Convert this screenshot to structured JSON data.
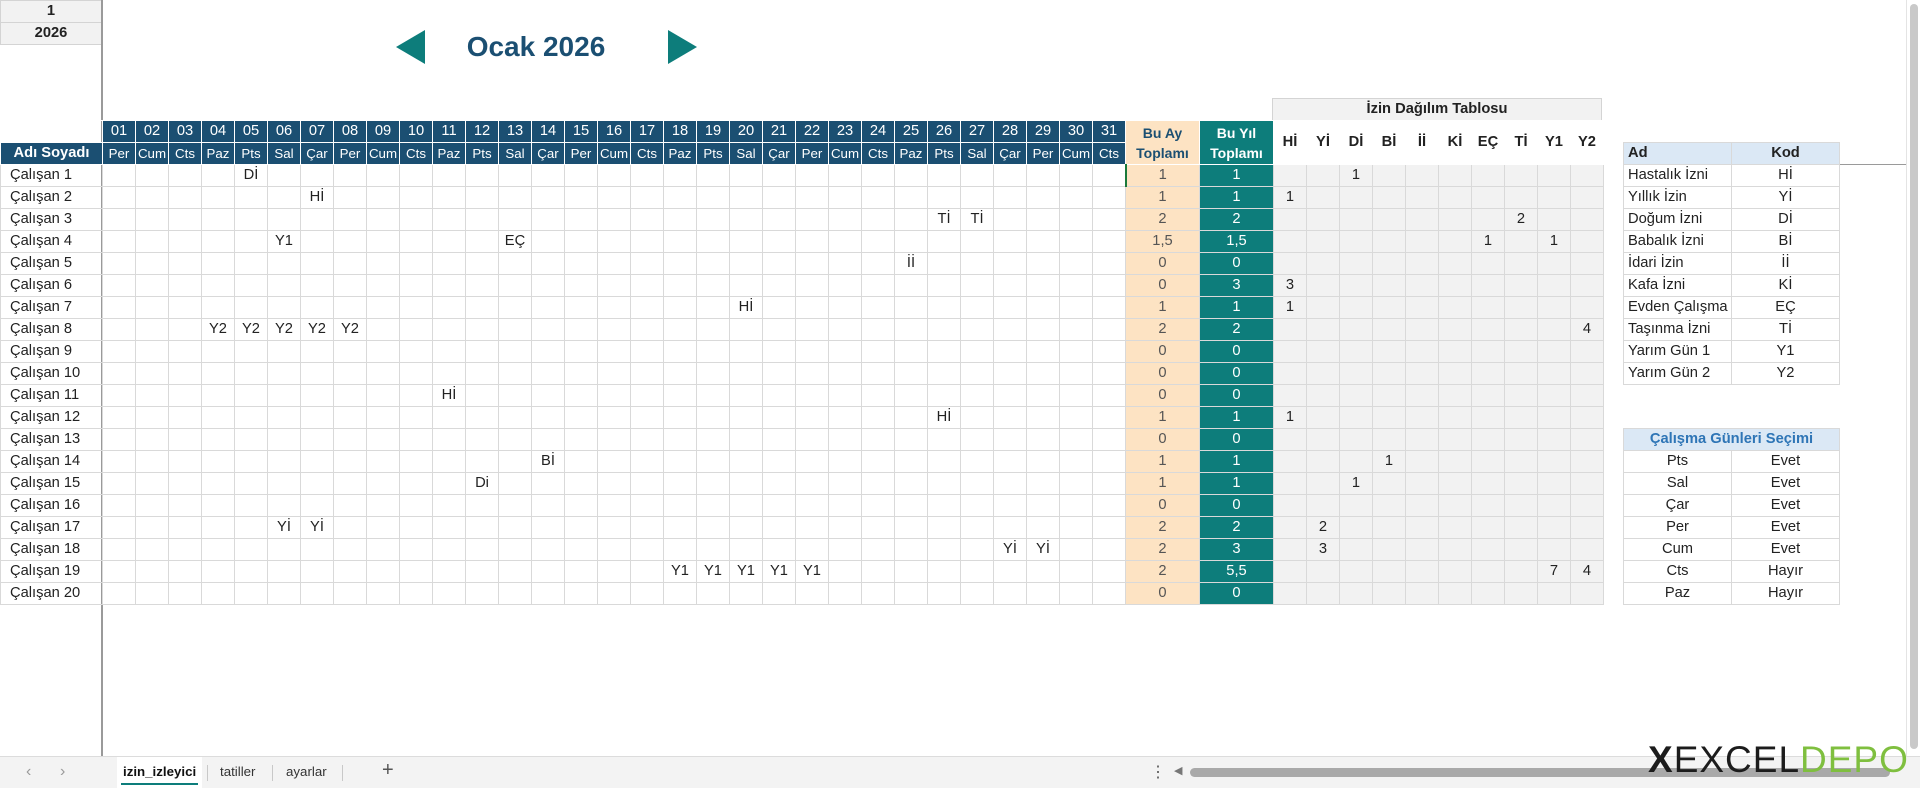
{
  "corner": {
    "month_num": "1",
    "year": "2026"
  },
  "nav": {
    "title": "Ocak 2026"
  },
  "grid": {
    "name_header": "Adı Soyadı",
    "month_total_header": "Bu Ay Toplamı",
    "year_total_header": "Bu Yıl Toplamı",
    "day_numbers": [
      "01",
      "02",
      "03",
      "04",
      "05",
      "06",
      "07",
      "08",
      "09",
      "10",
      "11",
      "12",
      "13",
      "14",
      "15",
      "16",
      "17",
      "18",
      "19",
      "20",
      "21",
      "22",
      "23",
      "24",
      "25",
      "26",
      "27",
      "28",
      "29",
      "30",
      "31"
    ],
    "day_names": [
      "Per",
      "Cum",
      "Cts",
      "Paz",
      "Pts",
      "Sal",
      "Çar",
      "Per",
      "Cum",
      "Cts",
      "Paz",
      "Pts",
      "Sal",
      "Çar",
      "Per",
      "Cum",
      "Cts",
      "Paz",
      "Pts",
      "Sal",
      "Çar",
      "Per",
      "Cum",
      "Cts",
      "Paz",
      "Pts",
      "Sal",
      "Çar",
      "Per",
      "Cum",
      "Cts"
    ],
    "distribution_title": "İzin Dağılım Tablosu",
    "distribution_codes": [
      "Hİ",
      "Yİ",
      "Dİ",
      "Bİ",
      "İİ",
      "Kİ",
      "EÇ",
      "Tİ",
      "Y1",
      "Y2"
    ],
    "employees": [
      {
        "name": "Çalışan 1",
        "leaves": {
          "5": "Dİ"
        },
        "month_total": "1",
        "year_total": "1",
        "dist": [
          "",
          "",
          "1",
          "",
          "",
          "",
          "",
          "",
          "",
          ""
        ]
      },
      {
        "name": "Çalışan 2",
        "leaves": {
          "7": "Hİ"
        },
        "month_total": "1",
        "year_total": "1",
        "dist": [
          "1",
          "",
          "",
          "",
          "",
          "",
          "",
          "",
          "",
          ""
        ]
      },
      {
        "name": "Çalışan 3",
        "leaves": {
          "26": "Tİ",
          "27": "Tİ"
        },
        "month_total": "2",
        "year_total": "2",
        "dist": [
          "",
          "",
          "",
          "",
          "",
          "",
          "",
          "2",
          "",
          ""
        ]
      },
      {
        "name": "Çalışan 4",
        "leaves": {
          "6": "Y1",
          "13": "EÇ"
        },
        "month_total": "1,5",
        "year_total": "1,5",
        "dist": [
          "",
          "",
          "",
          "",
          "",
          "",
          "1",
          "",
          "1",
          ""
        ]
      },
      {
        "name": "Çalışan 5",
        "leaves": {
          "25": "İİ"
        },
        "month_total": "0",
        "year_total": "0",
        "dist": [
          "",
          "",
          "",
          "",
          "",
          "",
          "",
          "",
          "",
          ""
        ]
      },
      {
        "name": "Çalışan 6",
        "leaves": {},
        "month_total": "0",
        "year_total": "3",
        "dist": [
          "3",
          "",
          "",
          "",
          "",
          "",
          "",
          "",
          "",
          ""
        ]
      },
      {
        "name": "Çalışan 7",
        "leaves": {
          "20": "Hİ"
        },
        "month_total": "1",
        "year_total": "1",
        "dist": [
          "1",
          "",
          "",
          "",
          "",
          "",
          "",
          "",
          "",
          ""
        ]
      },
      {
        "name": "Çalışan 8",
        "leaves": {
          "4": "Y2",
          "5": "Y2",
          "6": "Y2",
          "7": "Y2",
          "8": "Y2"
        },
        "month_total": "2",
        "year_total": "2",
        "dist": [
          "",
          "",
          "",
          "",
          "",
          "",
          "",
          "",
          "",
          "4"
        ]
      },
      {
        "name": "Çalışan 9",
        "leaves": {},
        "month_total": "0",
        "year_total": "0",
        "dist": [
          "",
          "",
          "",
          "",
          "",
          "",
          "",
          "",
          "",
          ""
        ]
      },
      {
        "name": "Çalışan 10",
        "leaves": {},
        "month_total": "0",
        "year_total": "0",
        "dist": [
          "",
          "",
          "",
          "",
          "",
          "",
          "",
          "",
          "",
          ""
        ]
      },
      {
        "name": "Çalışan 11",
        "leaves": {
          "11": "Hİ"
        },
        "month_total": "0",
        "year_total": "0",
        "dist": [
          "",
          "",
          "",
          "",
          "",
          "",
          "",
          "",
          "",
          ""
        ]
      },
      {
        "name": "Çalışan 12",
        "leaves": {
          "26": "Hİ"
        },
        "month_total": "1",
        "year_total": "1",
        "dist": [
          "1",
          "",
          "",
          "",
          "",
          "",
          "",
          "",
          "",
          ""
        ]
      },
      {
        "name": "Çalışan 13",
        "leaves": {},
        "month_total": "0",
        "year_total": "0",
        "dist": [
          "",
          "",
          "",
          "",
          "",
          "",
          "",
          "",
          "",
          ""
        ]
      },
      {
        "name": "Çalışan 14",
        "leaves": {
          "14": "Bİ"
        },
        "month_total": "1",
        "year_total": "1",
        "dist": [
          "",
          "",
          "",
          "1",
          "",
          "",
          "",
          "",
          "",
          ""
        ]
      },
      {
        "name": "Çalışan 15",
        "leaves": {
          "12": "Di"
        },
        "month_total": "1",
        "year_total": "1",
        "dist": [
          "",
          "",
          "1",
          "",
          "",
          "",
          "",
          "",
          "",
          ""
        ]
      },
      {
        "name": "Çalışan 16",
        "leaves": {},
        "month_total": "0",
        "year_total": "0",
        "dist": [
          "",
          "",
          "",
          "",
          "",
          "",
          "",
          "",
          "",
          ""
        ]
      },
      {
        "name": "Çalışan 17",
        "leaves": {
          "6": "Yİ",
          "7": "Yİ"
        },
        "month_total": "2",
        "year_total": "2",
        "dist": [
          "",
          "2",
          "",
          "",
          "",
          "",
          "",
          "",
          "",
          ""
        ]
      },
      {
        "name": "Çalışan 18",
        "leaves": {
          "28": "Yİ",
          "29": "Yİ"
        },
        "month_total": "2",
        "year_total": "3",
        "dist": [
          "",
          "3",
          "",
          "",
          "",
          "",
          "",
          "",
          "",
          ""
        ]
      },
      {
        "name": "Çalışan 19",
        "leaves": {
          "18": "Y1",
          "19": "Y1",
          "20": "Y1",
          "21": "Y1",
          "22": "Y1"
        },
        "month_total": "2",
        "year_total": "5,5",
        "dist": [
          "",
          "",
          "",
          "",
          "",
          "",
          "",
          "",
          "7",
          "4"
        ]
      },
      {
        "name": "Çalışan 20",
        "leaves": {},
        "month_total": "0",
        "year_total": "0",
        "dist": [
          "",
          "",
          "",
          "",
          "",
          "",
          "",
          "",
          "",
          ""
        ]
      }
    ]
  },
  "legend": {
    "header_name": "Ad",
    "header_code": "Kod",
    "items": [
      {
        "name": "Hastalık İzni",
        "code": "Hİ"
      },
      {
        "name": "Yıllık İzin",
        "code": "Yİ"
      },
      {
        "name": "Doğum İzni",
        "code": "Dİ"
      },
      {
        "name": "Babalık İzni",
        "code": "Bİ"
      },
      {
        "name": "İdari İzin",
        "code": "İİ"
      },
      {
        "name": "Kafa İzni",
        "code": "Kİ"
      },
      {
        "name": "Evden Çalışma",
        "code": "EÇ"
      },
      {
        "name": "Taşınma İzni",
        "code": "Tİ"
      },
      {
        "name": "Yarım Gün 1",
        "code": "Y1"
      },
      {
        "name": "Yarım Gün 2",
        "code": "Y2"
      }
    ]
  },
  "workdays": {
    "title": "Çalışma Günleri Seçimi",
    "items": [
      {
        "day": "Pts",
        "value": "Evet"
      },
      {
        "day": "Sal",
        "value": "Evet"
      },
      {
        "day": "Çar",
        "value": "Evet"
      },
      {
        "day": "Per",
        "value": "Evet"
      },
      {
        "day": "Cum",
        "value": "Evet"
      },
      {
        "day": "Cts",
        "value": "Hayır"
      },
      {
        "day": "Paz",
        "value": "Hayır"
      }
    ]
  },
  "tabs": {
    "prev": "‹",
    "next": "›",
    "sheets": [
      "izin_izleyici",
      "tatiller",
      "ayarlar"
    ],
    "active": "izin_izleyici",
    "add": "+",
    "more": "⋮"
  },
  "logo": {
    "x": "X",
    "excel": "EXCEL",
    "depo": "DEPO"
  },
  "colors": {
    "navy": "#1b4f72",
    "teal": "#0d7d7b",
    "peach": "#fde3c3",
    "lightblue": "#dbe8f5"
  }
}
